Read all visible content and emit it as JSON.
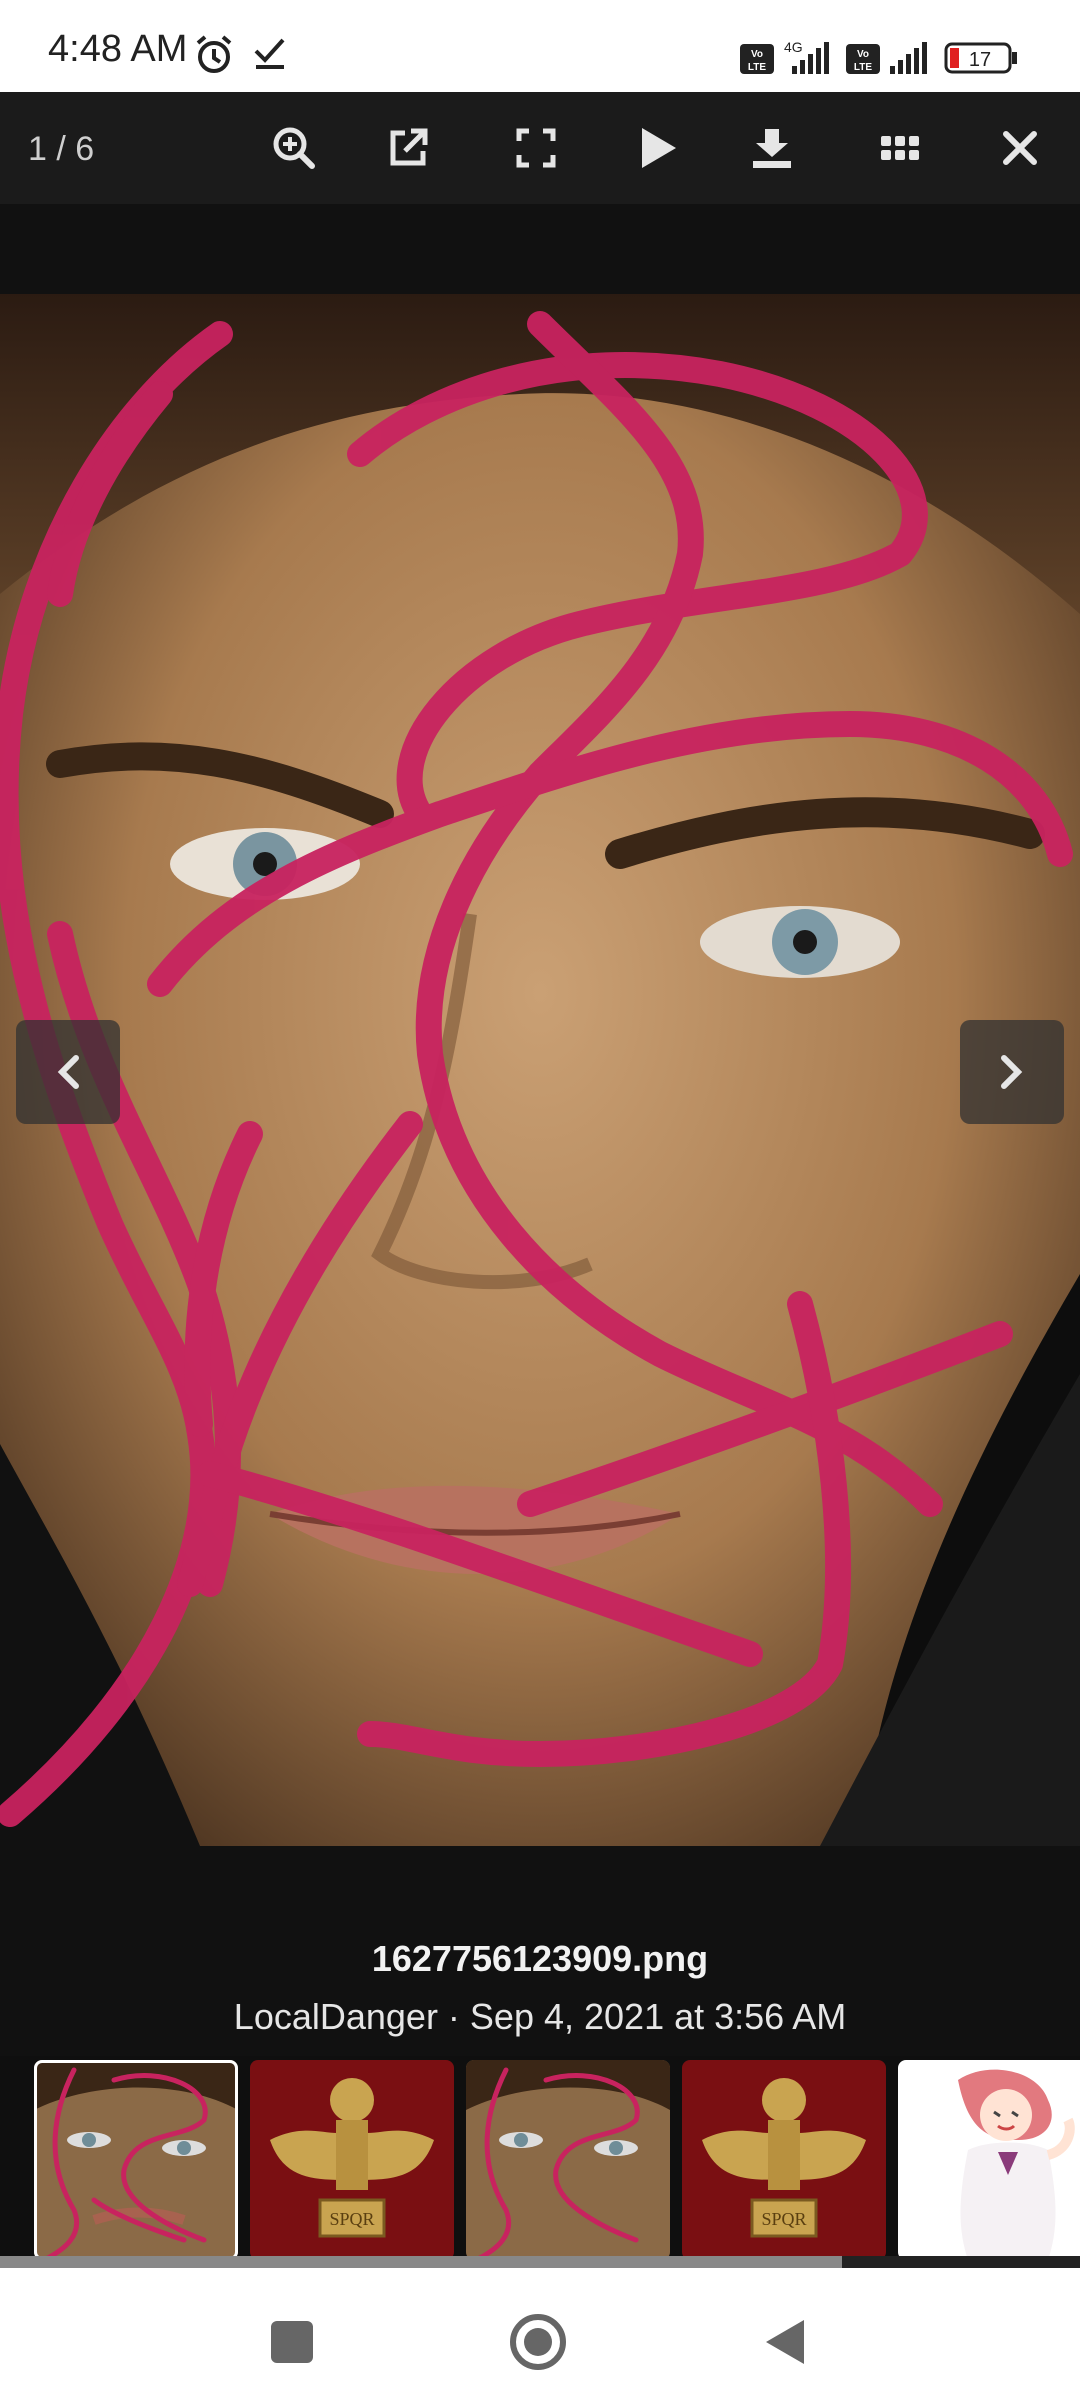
{
  "status_bar": {
    "time": "4:48 AM",
    "icons": [
      "alarm-icon",
      "check-icon",
      "volte-icon",
      "signal-4g-icon",
      "volte-icon",
      "signal-icon",
      "battery-icon"
    ],
    "network": "4G",
    "battery_level": "17"
  },
  "viewer": {
    "counter": "1 / 6",
    "tools": [
      "zoom-in-icon",
      "open-external-icon",
      "fullscreen-icon",
      "play-icon",
      "download-icon",
      "grid-icon",
      "close-icon"
    ]
  },
  "image": {
    "filename": "1627756123909.png",
    "meta": "LocalDanger · Sep 4, 2021 at 3:56 AM"
  },
  "thumbnails": [
    {
      "type": "face",
      "active": true
    },
    {
      "type": "eagle",
      "active": false,
      "label": "SPQR"
    },
    {
      "type": "face",
      "active": false
    },
    {
      "type": "eagle",
      "active": false,
      "label": "SPQR"
    },
    {
      "type": "anime",
      "active": false
    }
  ],
  "colors": {
    "scribble": "#c8235f",
    "toolbar_bg": "#1b1b1b",
    "eagle_gold": "#c9a450",
    "eagle_bg": "#7a0f12"
  }
}
